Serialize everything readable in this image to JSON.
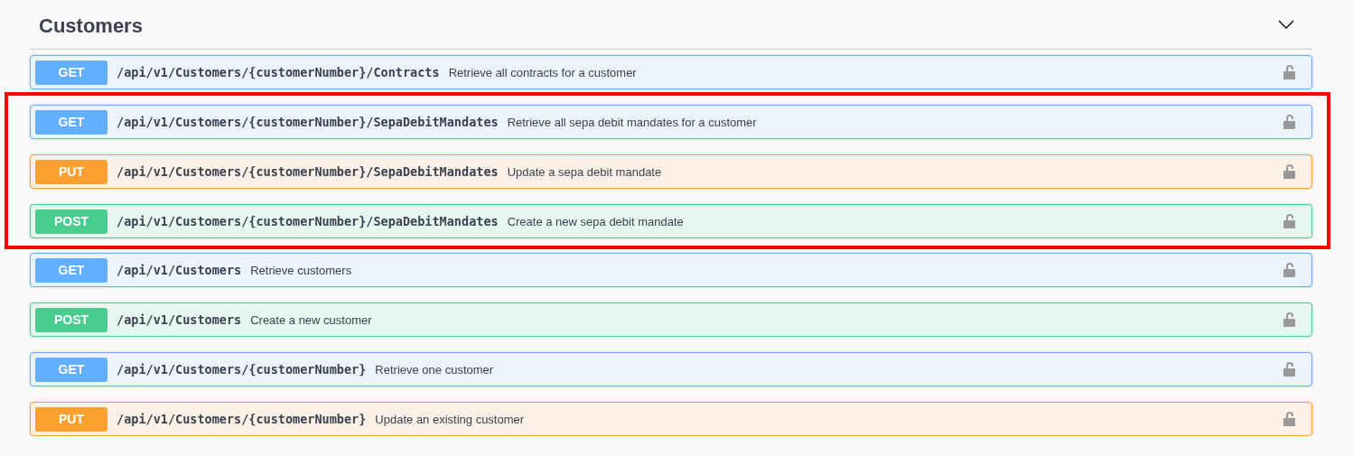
{
  "section": {
    "title": "Customers",
    "expanded": true
  },
  "operations": [
    {
      "method": "GET",
      "path": "/api/v1/Customers/{customerNumber}/Contracts",
      "summary": "Retrieve all contracts for a customer",
      "highlighted": false
    },
    {
      "method": "GET",
      "path": "/api/v1/Customers/{customerNumber}/SepaDebitMandates",
      "summary": "Retrieve all sepa debit mandates for a customer",
      "highlighted": true
    },
    {
      "method": "PUT",
      "path": "/api/v1/Customers/{customerNumber}/SepaDebitMandates",
      "summary": "Update a sepa debit mandate",
      "highlighted": true
    },
    {
      "method": "POST",
      "path": "/api/v1/Customers/{customerNumber}/SepaDebitMandates",
      "summary": "Create a new sepa debit mandate",
      "highlighted": true
    },
    {
      "method": "GET",
      "path": "/api/v1/Customers",
      "summary": "Retrieve customers",
      "highlighted": false
    },
    {
      "method": "POST",
      "path": "/api/v1/Customers",
      "summary": "Create a new customer",
      "highlighted": false
    },
    {
      "method": "GET",
      "path": "/api/v1/Customers/{customerNumber}",
      "summary": "Retrieve one customer",
      "highlighted": false
    },
    {
      "method": "PUT",
      "path": "/api/v1/Customers/{customerNumber}",
      "summary": "Update an existing customer",
      "highlighted": false
    }
  ]
}
